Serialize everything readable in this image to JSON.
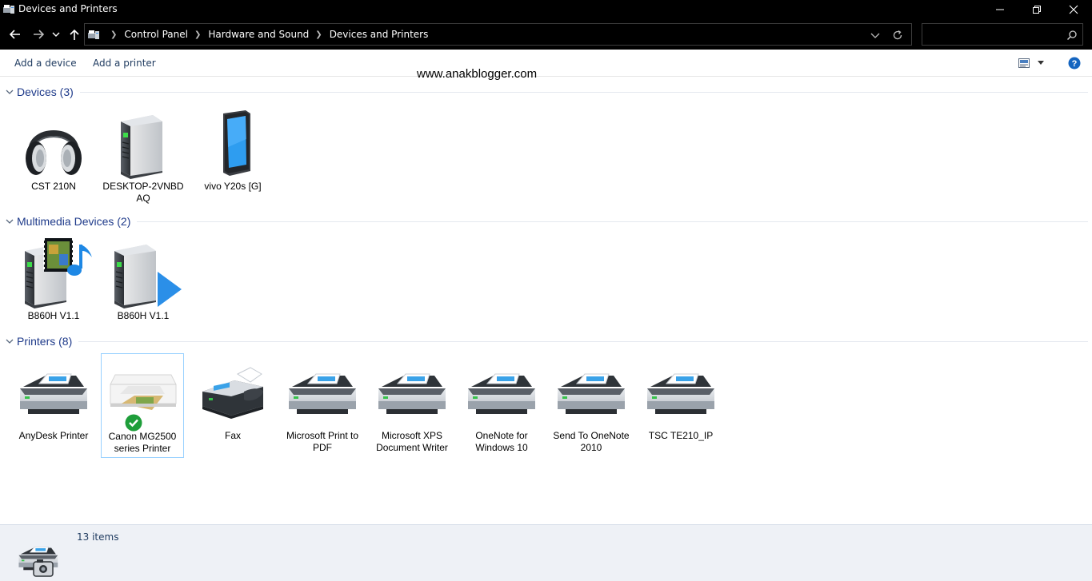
{
  "window": {
    "title": "Devices and Printers"
  },
  "nav": {
    "breadcrumbs": [
      "Control Panel",
      "Hardware and Sound",
      "Devices and Printers"
    ],
    "search_placeholder": ""
  },
  "toolbar": {
    "add_device": "Add a device",
    "add_printer": "Add a printer"
  },
  "watermark": "www.anakblogger.com",
  "groups": {
    "devices": {
      "title": "Devices (3)",
      "items": [
        "CST 210N",
        "DESKTOP-2VNBD AQ",
        "vivo Y20s [G]"
      ]
    },
    "multimedia": {
      "title": "Multimedia Devices (2)",
      "items": [
        "B860H V1.1",
        "B860H V1.1"
      ]
    },
    "printers": {
      "title": "Printers (8)",
      "items": [
        "AnyDesk Printer",
        "Canon MG2500 series Printer",
        "Fax",
        "Microsoft Print to PDF",
        "Microsoft XPS Document Writer",
        "OneNote for Windows 10",
        "Send To OneNote 2010",
        "TSC TE210_IP"
      ]
    }
  },
  "status": {
    "count": "13 items"
  },
  "colors": {
    "accent": "#1e3a8a",
    "titlebar": "#000000",
    "selection": "#99d1ff"
  }
}
